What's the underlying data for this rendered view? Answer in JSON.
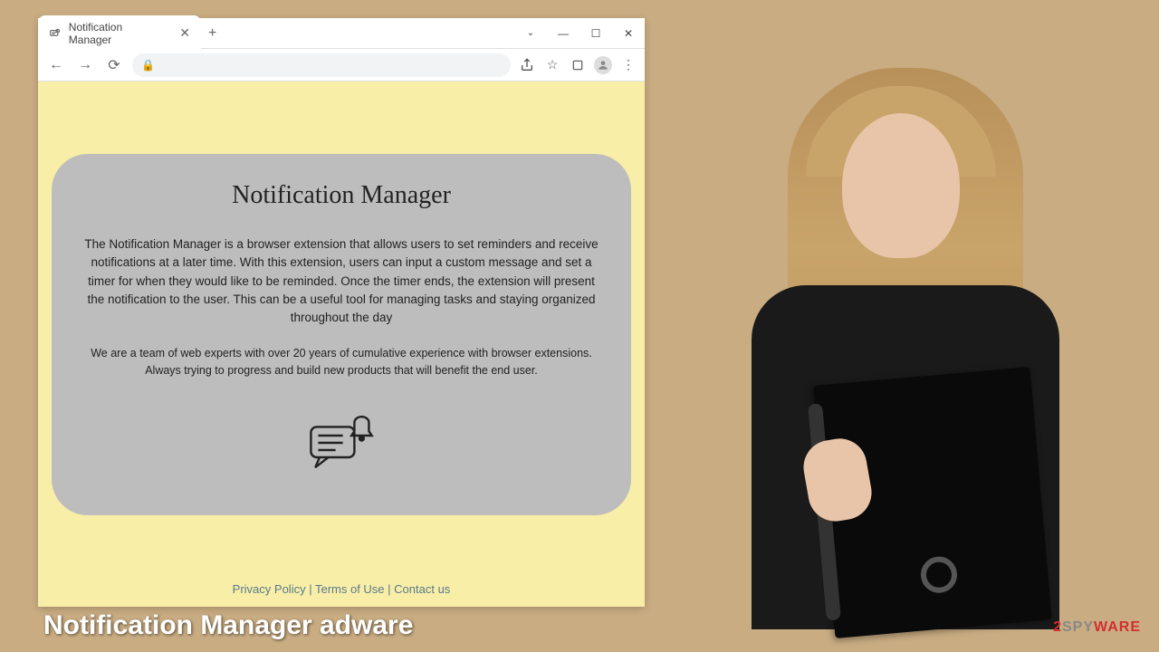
{
  "browser": {
    "tab": {
      "title": "Notification Manager"
    },
    "window_controls": {
      "chevron": "⌄",
      "minimize": "—",
      "maximize": "☐",
      "close": "✕"
    }
  },
  "page": {
    "heading": "Notification Manager",
    "description": "The Notification Manager is a browser extension that allows users to set reminders and receive notifications at a later time. With this extension, users can input a custom message and set a timer for when they would like to be reminded. Once the timer ends, the extension will present the notification to the user. This can be a useful tool for managing tasks and staying organized throughout the day",
    "team_text": "We are a team of web experts with over 20 years of cumulative experience with browser extensions. Always trying to progress and build new products that will benefit the end user.",
    "footer": {
      "privacy": "Privacy Policy",
      "sep1": " | ",
      "terms": "Terms of Use",
      "sep2": " | ",
      "contact": "Contact us"
    }
  },
  "caption": "Notification Manager adware",
  "watermark": {
    "prefix": "2",
    "mid": "SPY",
    "suffix": "WARE"
  }
}
